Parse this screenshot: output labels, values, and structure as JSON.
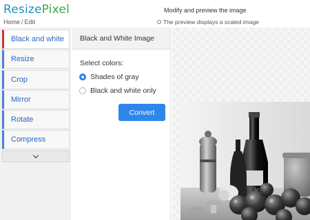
{
  "app": {
    "logo_part1": "Resize",
    "logo_part2": "Pixel",
    "logo_colors": {
      "part1": "#1f8fc6",
      "part2": "#3aa843"
    }
  },
  "breadcrumb": {
    "home": "Home",
    "separator": "/",
    "current": "Edit"
  },
  "header": {
    "title": "Modify and preview the image",
    "note": "The preview displays a scaled image",
    "note_icon": "info-icon"
  },
  "sidebar": {
    "items": [
      {
        "label": "Black and white",
        "active": true
      },
      {
        "label": "Resize",
        "active": false
      },
      {
        "label": "Crop",
        "active": false
      },
      {
        "label": "Mirror",
        "active": false
      },
      {
        "label": "Rotate",
        "active": false
      },
      {
        "label": "Compress",
        "active": false
      }
    ],
    "more_icon": "chevron-down-icon",
    "accent_color": "#4a7fd6",
    "active_accent_color": "#c0392b"
  },
  "panel": {
    "title": "Black and White Image",
    "colors_label": "Select colors:",
    "options": [
      {
        "label": "Shades of gray",
        "selected": true
      },
      {
        "label": "Black and white only",
        "selected": false
      }
    ],
    "convert_label": "Convert",
    "button_color": "#2f86ea"
  },
  "preview": {
    "image_alt": "Grayscale still life photo"
  }
}
